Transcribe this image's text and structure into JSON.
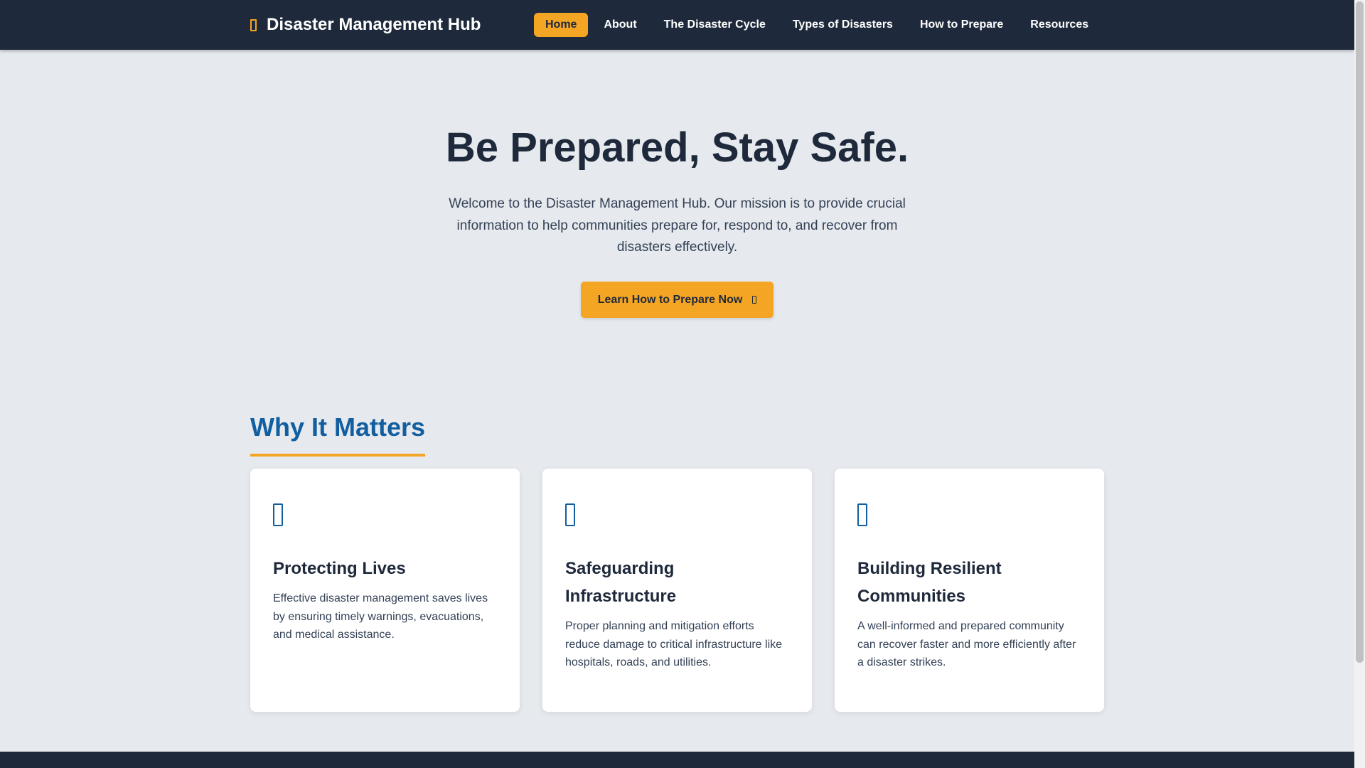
{
  "brand": {
    "title": "Disaster Management Hub",
    "icon": "shield-icon"
  },
  "nav": {
    "items": [
      {
        "label": "Home",
        "active": true
      },
      {
        "label": "About",
        "active": false
      },
      {
        "label": "The Disaster Cycle",
        "active": false
      },
      {
        "label": "Types of Disasters",
        "active": false
      },
      {
        "label": "How to Prepare",
        "active": false
      },
      {
        "label": "Resources",
        "active": false
      }
    ]
  },
  "hero": {
    "title": "Be Prepared, Stay Safe.",
    "text": "Welcome to the Disaster Management Hub. Our mission is to provide crucial information to help communities prepare for, respond to, and recover from disasters effectively.",
    "cta_label": "Learn How to Prepare Now",
    "cta_icon": "arrow-right-icon"
  },
  "why": {
    "title": "Why It Matters",
    "cards": [
      {
        "icon": "heart-icon",
        "title": "Protecting Lives",
        "text": "Effective disaster management saves lives by ensuring timely warnings, evacuations, and medical assistance."
      },
      {
        "icon": "building-icon",
        "title": "Safeguarding Infrastructure",
        "text": "Proper planning and mitigation efforts reduce damage to critical infrastructure like hospitals, roads, and utilities."
      },
      {
        "icon": "users-icon",
        "title": "Building Resilient Communities",
        "text": "A well-informed and prepared community can recover faster and more efficiently after a disaster strikes."
      }
    ]
  },
  "colors": {
    "navbar": "#1e293b",
    "accent": "#f5a524",
    "heading_blue": "#115ea0",
    "background": "#e6e9ed"
  }
}
